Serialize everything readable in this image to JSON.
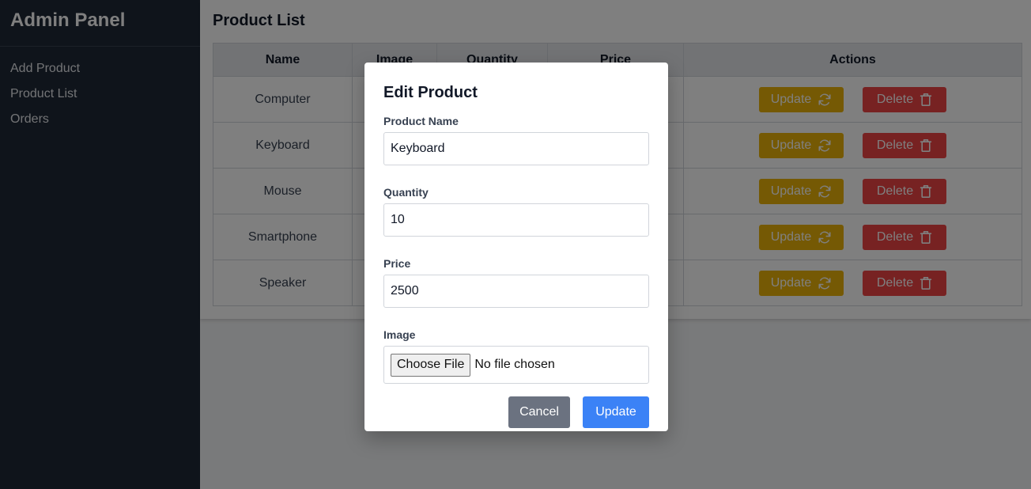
{
  "sidebar": {
    "title": "Admin Panel",
    "items": [
      {
        "label": "Add Product"
      },
      {
        "label": "Product List"
      },
      {
        "label": "Orders"
      }
    ]
  },
  "main": {
    "title": "Product List",
    "table": {
      "headers": [
        "Name",
        "Image",
        "Quantity",
        "Price",
        "Actions"
      ],
      "rows": [
        {
          "name": "Computer"
        },
        {
          "name": "Keyboard"
        },
        {
          "name": "Mouse"
        },
        {
          "name": "Smartphone"
        },
        {
          "name": "Speaker"
        }
      ],
      "update_label": "Update",
      "delete_label": "Delete"
    }
  },
  "modal": {
    "title": "Edit Product",
    "fields": {
      "name": {
        "label": "Product Name",
        "value": "Keyboard"
      },
      "quantity": {
        "label": "Quantity",
        "value": "10"
      },
      "price": {
        "label": "Price",
        "value": "2500"
      },
      "image": {
        "label": "Image",
        "button": "Choose File",
        "status": "No file chosen"
      }
    },
    "cancel_label": "Cancel",
    "submit_label": "Update"
  },
  "colors": {
    "sidebar_bg": "#1f2937",
    "update": "#eab308",
    "delete": "#ef4444",
    "cancel": "#6b7280",
    "primary": "#3b82f6"
  },
  "icons": {
    "update": "refresh-icon",
    "delete": "trash-icon"
  }
}
